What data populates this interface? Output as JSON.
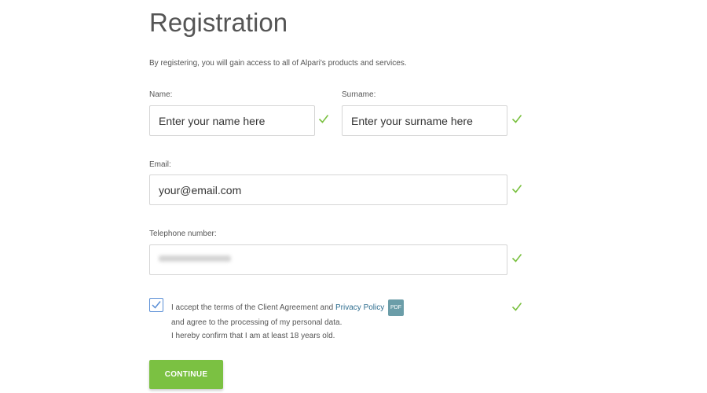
{
  "page": {
    "title": "Registration",
    "intro": "By registering, you will gain access to all of Alpari's products and services."
  },
  "form": {
    "name": {
      "label": "Name:",
      "placeholder": "Enter your name here",
      "valid_icon": "checkmark-icon"
    },
    "surname": {
      "label": "Surname:",
      "placeholder": "Enter your surname here",
      "valid_icon": "checkmark-icon"
    },
    "email": {
      "label": "Email:",
      "placeholder": "your@email.com",
      "valid_icon": "checkmark-icon"
    },
    "phone": {
      "label": "Telephone number:",
      "value_obscured": true,
      "valid_icon": "checkmark-icon"
    },
    "terms": {
      "checked": true,
      "line1_prefix": "I accept the terms of the Client Agreement and ",
      "link": "Privacy Policy",
      "pdf_badge": "PDF",
      "line2": "and agree to the processing of my personal data.",
      "line3": "I hereby confirm that I am at least 18 years old.",
      "valid_icon": "checkmark-icon"
    },
    "submit_label": "CONTINUE"
  },
  "colors": {
    "accent_green": "#7bc142",
    "check_green": "#7bc142",
    "link_blue": "#2f6e8f",
    "checkbox_border": "#5b8fd6"
  }
}
